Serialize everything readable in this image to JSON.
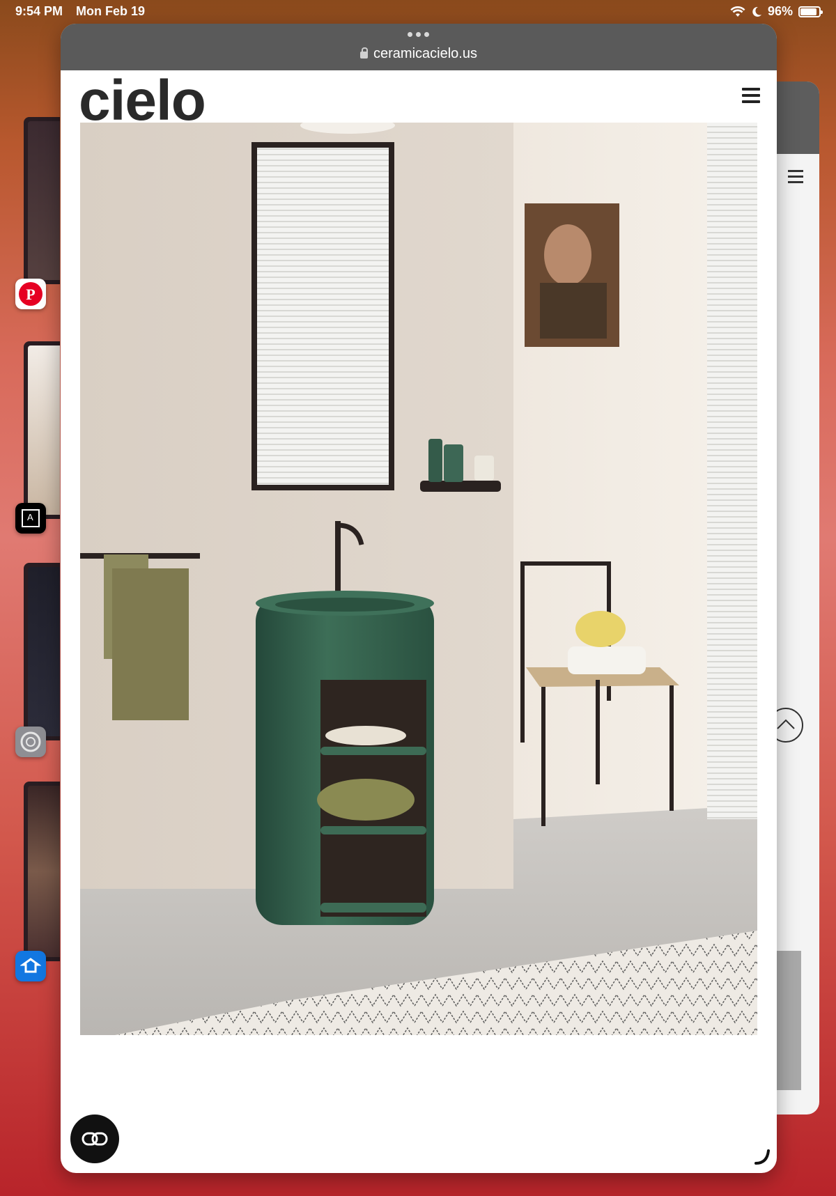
{
  "status_bar": {
    "time": "9:54 PM",
    "date": "Mon Feb 19",
    "battery": "96%",
    "battery_level": 0.96
  },
  "browser": {
    "url": "ceramicacielo.us"
  },
  "site": {
    "logo": "cielo"
  },
  "icons": [
    "wifi-icon",
    "moon-icon",
    "battery-icon",
    "lock-icon",
    "hamburger-menu-icon",
    "pinterest-icon",
    "text-app-icon",
    "settings-icon",
    "zillow-icon",
    "chat-icon",
    "scroll-up-icon",
    "resize-handle-icon"
  ],
  "colors": {
    "brand": "#2a2a2a",
    "vanity_green": "#2f5a44",
    "wall": "#e6ddd2"
  }
}
